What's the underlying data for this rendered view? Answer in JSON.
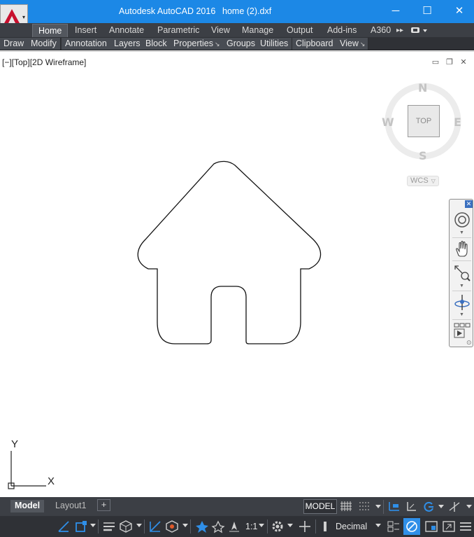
{
  "window": {
    "app_title": "Autodesk AutoCAD 2016",
    "file_name": "home (2).dxf",
    "minimize_glyph": "─",
    "maximize_glyph": "☐",
    "close_glyph": "✕"
  },
  "ribbon": {
    "tabs": [
      "Home",
      "Insert",
      "Annotate",
      "Parametric",
      "View",
      "Manage",
      "Output",
      "Add-ins",
      "A360"
    ],
    "active_tab": "Home",
    "panels": [
      "Draw",
      "Modify",
      "Annotation",
      "Layers",
      "Block",
      "Properties",
      "Groups",
      "Utilities",
      "Clipboard",
      "View"
    ],
    "more_glyph": "▸▸"
  },
  "viewport": {
    "label": "[−][Top][2D Wireframe]",
    "compass": {
      "north": "N",
      "south": "S",
      "east": "E",
      "west": "W"
    },
    "cube_face": "TOP",
    "wcs_label": "WCS",
    "ucs": {
      "x_label": "X",
      "y_label": "Y"
    }
  },
  "layout_tabs": {
    "tabs": [
      "Model",
      "Layout1"
    ],
    "active": "Model",
    "add_glyph": "+"
  },
  "status_bar": {
    "model_label": "MODEL",
    "scale": "1:1",
    "units": "Decimal"
  },
  "colors": {
    "title_bar": "#1c88e6",
    "ribbon_dark": "#3c3f45",
    "accent_blue": "#2f8fe8",
    "logo_red": "#c8102e"
  }
}
